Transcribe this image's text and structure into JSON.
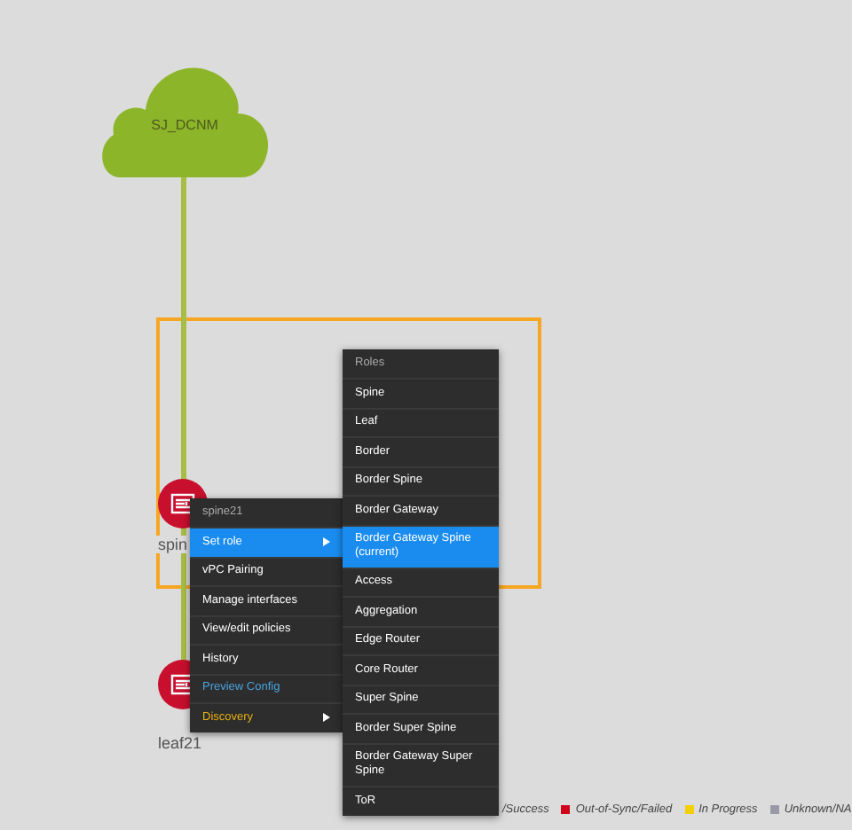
{
  "cloud": {
    "label": "SJ_DCNM"
  },
  "nodes": [
    {
      "label": "spin",
      "color": "#c8102e"
    },
    {
      "label": "leaf21",
      "color": "#c8102e"
    }
  ],
  "context_menu": {
    "title": "spine21",
    "items": [
      {
        "label": "Set role",
        "kind": "submenu",
        "selected": true,
        "color": "#ffffff"
      },
      {
        "label": "vPC Pairing",
        "kind": "plain",
        "selected": false,
        "color": "#ffffff"
      },
      {
        "label": "Manage interfaces",
        "kind": "plain",
        "selected": false,
        "color": "#ffffff"
      },
      {
        "label": "View/edit policies",
        "kind": "plain",
        "selected": false,
        "color": "#ffffff"
      },
      {
        "label": "History",
        "kind": "plain",
        "selected": false,
        "color": "#ffffff"
      },
      {
        "label": "Preview Config",
        "kind": "plain",
        "selected": false,
        "color": "#4aa3df"
      },
      {
        "label": "Discovery",
        "kind": "submenu",
        "selected": false,
        "color": "#e8b012"
      }
    ]
  },
  "roles_menu": {
    "title": "Roles",
    "items": [
      {
        "label": "Spine",
        "selected": false
      },
      {
        "label": "Leaf",
        "selected": false
      },
      {
        "label": "Border",
        "selected": false
      },
      {
        "label": "Border Spine",
        "selected": false
      },
      {
        "label": "Border Gateway",
        "selected": false
      },
      {
        "label": "Border Gateway Spine (current)",
        "selected": true
      },
      {
        "label": "Access",
        "selected": false
      },
      {
        "label": "Aggregation",
        "selected": false
      },
      {
        "label": "Edge Router",
        "selected": false
      },
      {
        "label": "Core Router",
        "selected": false
      },
      {
        "label": "Super Spine",
        "selected": false
      },
      {
        "label": "Border Super Spine",
        "selected": false
      },
      {
        "label": "Border Gateway Super Spine",
        "selected": false
      },
      {
        "label": "ToR",
        "selected": false
      }
    ]
  },
  "legend": [
    {
      "label": "/Success"
    },
    {
      "label": "Out-of-Sync/Failed",
      "color": "#d0021b"
    },
    {
      "label": "In Progress",
      "color": "#f5d000"
    },
    {
      "label": "Unknown/NA",
      "color": "#9a9aa6"
    }
  ]
}
